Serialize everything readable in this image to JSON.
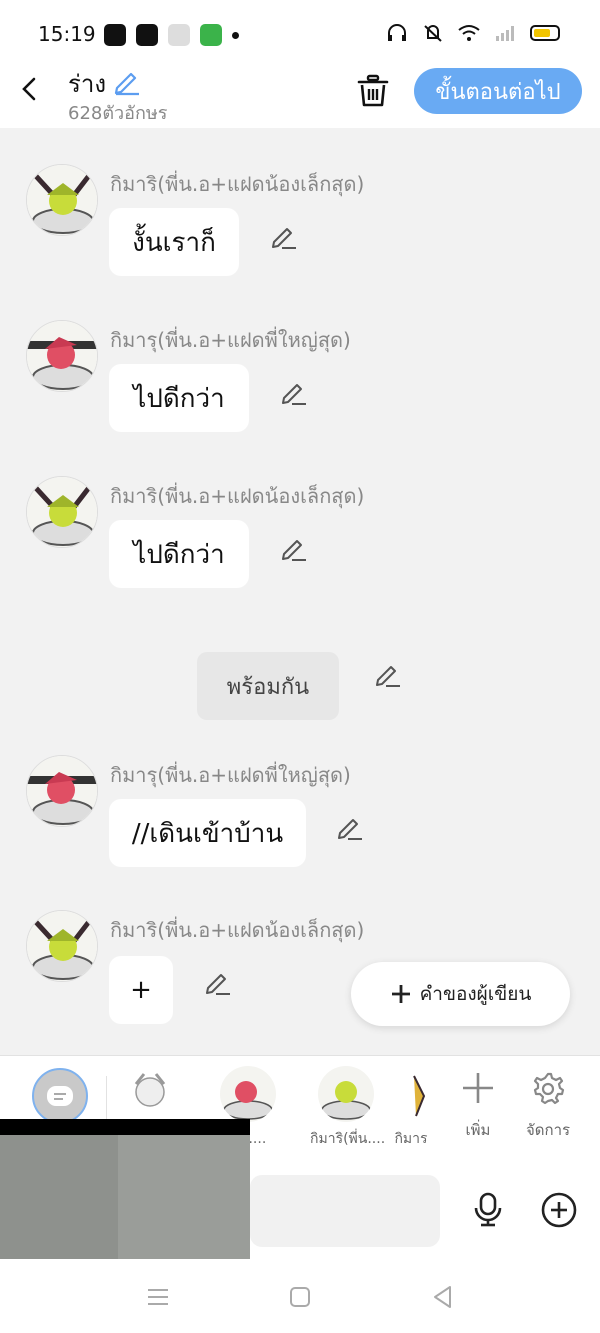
{
  "status": {
    "time": "15:19"
  },
  "header": {
    "title": "ร่าง",
    "subtitle": "628ตัวอักษร",
    "next_label": "ขั้นตอนต่อไป"
  },
  "messages": [
    {
      "name": "กิมาริ(พี่น.อ+แฝดน้องเล็กสุด)",
      "text": "งั้นเราก็",
      "avatar": "green-character"
    },
    {
      "name": "กิมารุ(พี่น.อ+แฝดพี่ใหญ่สุด)",
      "text": "ไปดีกว่า",
      "avatar": "red-character"
    },
    {
      "name": "กิมาริ(พี่น.อ+แฝดน้องเล็กสุด)",
      "text": "ไปดีกว่า",
      "avatar": "green-character"
    },
    {
      "name": "กิมารุ(พี่น.อ+แฝดพี่ใหญ่สุด)",
      "text": "//เดินเข้าบ้าน",
      "avatar": "red-character"
    },
    {
      "name": "กิมาริ(พี่น.อ+แฝดน้องเล็กสุด)",
      "text": "+",
      "avatar": "green-character"
    }
  ],
  "center_message": {
    "text": "พร้อมกัน"
  },
  "author_button": {
    "label": "คำของผู้เขียน"
  },
  "characters": [
    {
      "name": "",
      "avatar": "white-character"
    },
    {
      "name": "พี่น....",
      "avatar": "red-character"
    },
    {
      "name": "กิมาริ(พี่น....",
      "avatar": "green-character"
    },
    {
      "name": "กิมาร",
      "avatar": "yellow-character"
    }
  ],
  "tools": {
    "add_label": "เพิ่ม",
    "manage_label": "จัดการ"
  },
  "colors": {
    "accent": "#69aaf3",
    "bg": "#f2f2f2"
  }
}
